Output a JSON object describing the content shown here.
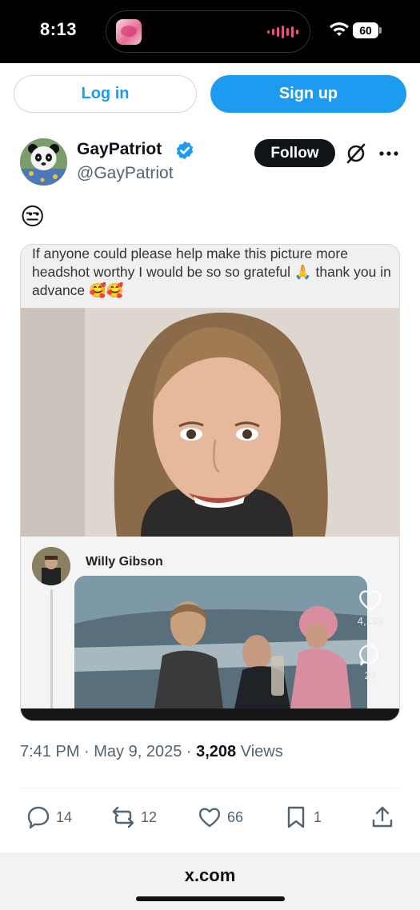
{
  "status": {
    "time": "8:13",
    "battery": "60"
  },
  "auth": {
    "login_label": "Log in",
    "signup_label": "Sign up"
  },
  "author": {
    "name": "GayPatriot",
    "handle": "@GayPatriot",
    "follow_label": "Follow"
  },
  "post": {
    "emoji": "😒",
    "media": {
      "caption": "If anyone could please help make this picture more headshot worthy I would be so so grateful 🙏 thank you in advance 🥰🥰",
      "commenter_name": "Willy Gibson",
      "like_count": "4,139",
      "reply_count": "24"
    },
    "time": "7:41 PM",
    "date": "May 9, 2025",
    "views_count": "3,208",
    "views_label": "Views"
  },
  "stats": {
    "replies": "14",
    "reposts": "12",
    "likes": "66",
    "bookmarks": "1"
  },
  "browser": {
    "url": "x.com"
  },
  "colors": {
    "accent": "#1d9bf0",
    "text": "#0f1419",
    "secondary": "#536471"
  }
}
